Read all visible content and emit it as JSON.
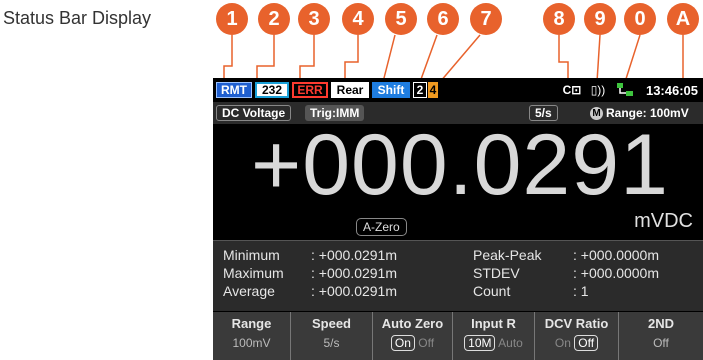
{
  "title": "Status Bar Display",
  "callouts": [
    "1",
    "2",
    "3",
    "4",
    "5",
    "6",
    "7",
    "8",
    "9",
    "0",
    "A"
  ],
  "status_bar": {
    "remote": "RMT",
    "interface": "232",
    "error": "ERR",
    "rear": "Rear",
    "shift": "Shift",
    "digit_a": "2",
    "digit_b": "4",
    "card_icon": "C⊡",
    "beep_icon": "▯))",
    "time": "13:46:05",
    "colors": {
      "remote": "#1f5fd0",
      "error": "#ff3b30",
      "shift": "#1f7de0",
      "digit_b": "#f09a20",
      "lan": "#3ec43e"
    }
  },
  "meas_line": {
    "function": "DC Voltage",
    "trigger": "Trig:IMM",
    "rate": "5/s",
    "range_mode": "M",
    "range": "Range: 100mV"
  },
  "reading": {
    "value": "+000.0291",
    "azero": "A-Zero",
    "unit": "mVDC"
  },
  "stats": {
    "left": [
      {
        "label": "Minimum",
        "value": ": +000.0291m"
      },
      {
        "label": "Maximum",
        "value": ": +000.0291m"
      },
      {
        "label": "Average",
        "value": ": +000.0291m"
      }
    ],
    "right": [
      {
        "label": "Peak-Peak",
        "value": ": +000.0000m"
      },
      {
        "label": "STDEV",
        "value": ": +000.0000m"
      },
      {
        "label": "Count",
        "value": ": 1"
      }
    ]
  },
  "softkeys": [
    {
      "label": "Range",
      "value": "100mV"
    },
    {
      "label": "Speed",
      "value": "5/s"
    },
    {
      "label": "Auto Zero",
      "on": "On",
      "off": "Off"
    },
    {
      "label": "Input R",
      "on": "10M",
      "off": "Auto"
    },
    {
      "label": "DCV Ratio",
      "on": "On",
      "off": "Off"
    },
    {
      "label": "2ND",
      "value": "Off"
    }
  ]
}
